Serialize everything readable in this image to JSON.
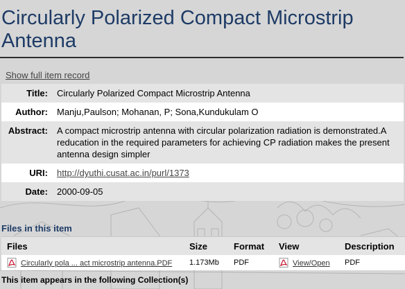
{
  "item": {
    "title": "Circularly Polarized Compact Microstrip Antenna",
    "show_full_record": "Show full item record"
  },
  "metadata": [
    {
      "label": "Title:",
      "value": "Circularly Polarized Compact Microstrip Antenna"
    },
    {
      "label": "Author:",
      "value": "Manju,Paulson; Mohanan, P; Sona,Kundukulam O"
    },
    {
      "label": "Abstract:",
      "value": "A compact microstrip antenna with circular polarization radiation is demonstrated.A reducation in the required parameters for achieving CP radiation makes the present antenna design simpler"
    },
    {
      "label": "URI:",
      "value": "http://dyuthi.cusat.ac.in/purl/1373"
    },
    {
      "label": "Date:",
      "value": "2000-09-05"
    }
  ],
  "files_section": {
    "heading": "Files in this item",
    "columns": [
      "Files",
      "Size",
      "Format",
      "View",
      "Description"
    ],
    "rows": [
      {
        "file": "Circularly pola ... act microstrip antenna.PDF",
        "size": "1.173Mb",
        "format": "PDF",
        "view": "View/Open",
        "description": "PDF",
        "icon": "pdf-icon"
      }
    ]
  },
  "collections_heading": "This item appears in the following Collection(s)",
  "colors": {
    "title": "#1d3b66",
    "background": "#d6d6d6",
    "row_alt": "#e4e4e4"
  }
}
